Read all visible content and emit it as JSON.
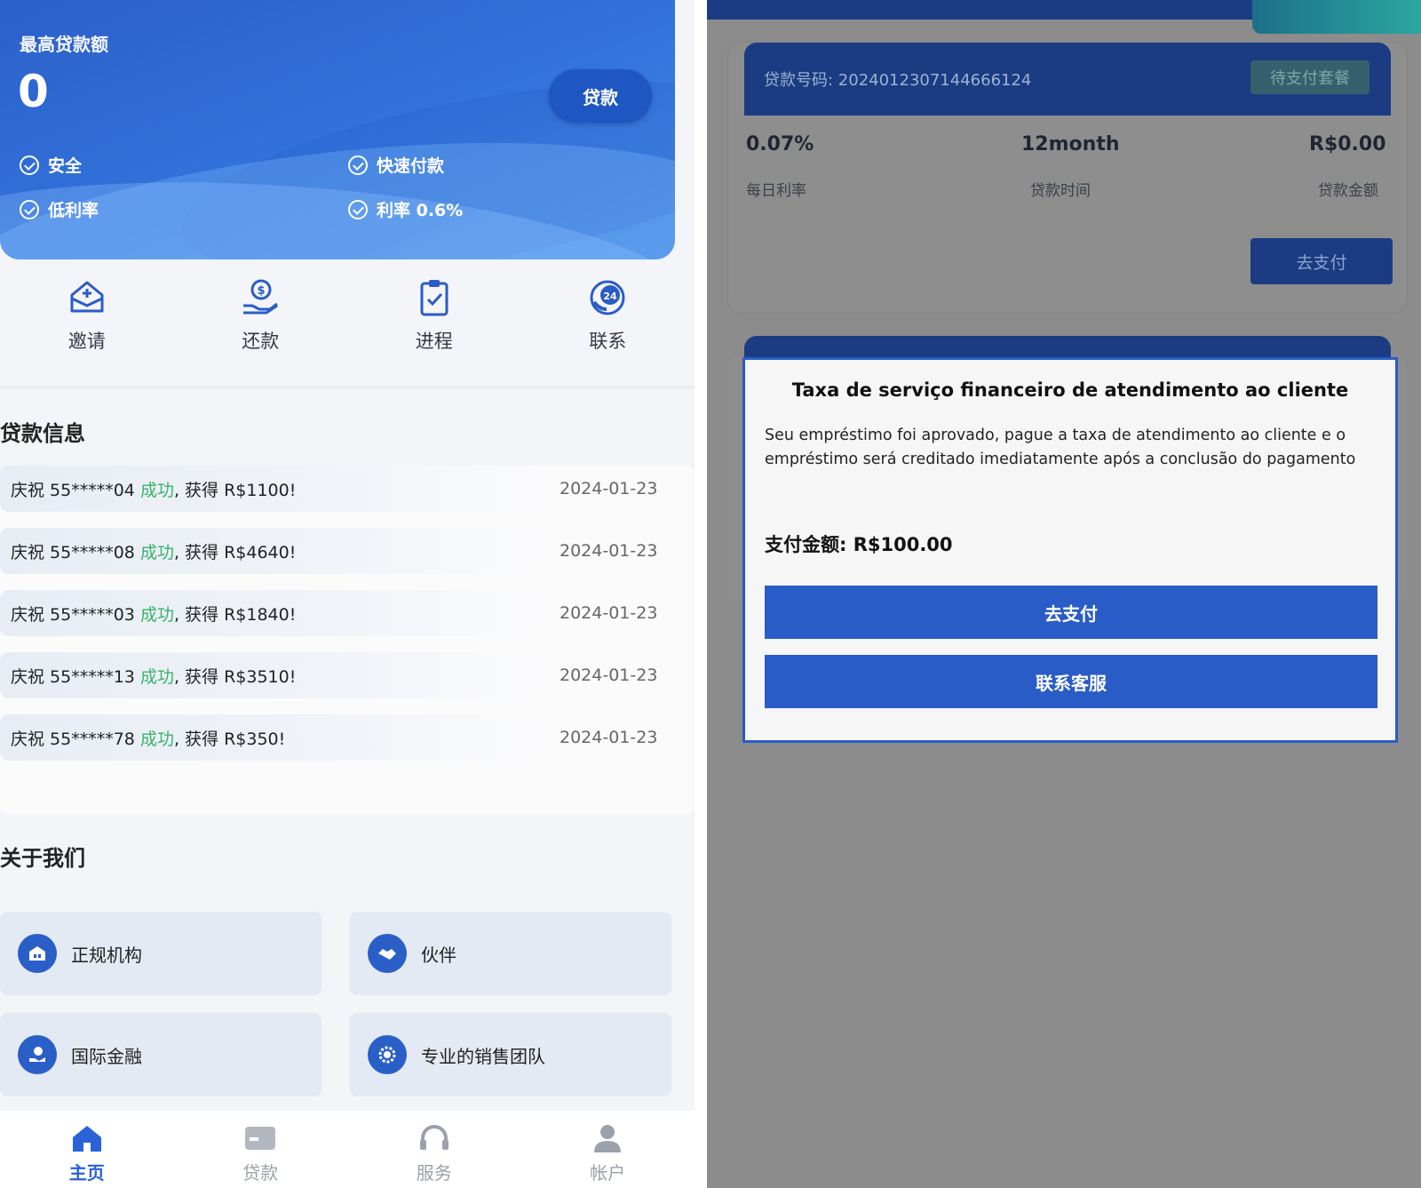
{
  "home": {
    "hero": {
      "label": "最高贷款额",
      "amount": "0",
      "button": "贷款",
      "features": [
        "安全",
        "快速付款",
        "低利率",
        "利率 0.6%"
      ]
    },
    "quick_actions": [
      {
        "label": "邀请",
        "icon": "invite-box-icon"
      },
      {
        "label": "还款",
        "icon": "repay-hand-coin-icon"
      },
      {
        "label": "进程",
        "icon": "clipboard-check-icon"
      },
      {
        "label": "联系",
        "icon": "24h-service-icon"
      }
    ],
    "loan_info_title": "贷款信息",
    "loan_records": [
      {
        "prefix": "庆祝 55*****04 ",
        "status": "成功",
        "suffix": ", 获得 R$1100!",
        "date": "2024-01-23"
      },
      {
        "prefix": "庆祝 55*****08 ",
        "status": "成功",
        "suffix": ", 获得 R$4640!",
        "date": "2024-01-23"
      },
      {
        "prefix": "庆祝 55*****03 ",
        "status": "成功",
        "suffix": ", 获得 R$1840!",
        "date": "2024-01-23"
      },
      {
        "prefix": "庆祝 55*****13 ",
        "status": "成功",
        "suffix": ", 获得 R$3510!",
        "date": "2024-01-23"
      },
      {
        "prefix": "庆祝 55*****78 ",
        "status": "成功",
        "suffix": ", 获得 R$350!",
        "date": "2024-01-23"
      }
    ],
    "about_title": "关于我们",
    "about_items": [
      {
        "label": "正规机构",
        "icon": "institution-icon"
      },
      {
        "label": "伙伴",
        "icon": "handshake-icon"
      },
      {
        "label": "国际金融",
        "icon": "finance-icon"
      },
      {
        "label": "专业的销售团队",
        "icon": "team-gear-icon"
      }
    ],
    "tabs": [
      {
        "label": "主页",
        "icon": "home-icon",
        "active": true
      },
      {
        "label": "贷款",
        "icon": "card-icon",
        "active": false
      },
      {
        "label": "服务",
        "icon": "headset-icon",
        "active": false
      },
      {
        "label": "帐户",
        "icon": "user-icon",
        "active": false
      }
    ]
  },
  "order": {
    "loan_number": "贷款号码: 2024012307144666124",
    "status": "待支付套餐",
    "stats": [
      {
        "value": "0.07%",
        "label": "每日利率"
      },
      {
        "value": "12month",
        "label": "贷款时间"
      },
      {
        "value": "R$0.00",
        "label": "贷款金额"
      }
    ],
    "pay_button": "去支付"
  },
  "modal": {
    "title": "Taxa de serviço financeiro de atendimento ao cliente",
    "body": "Seu empréstimo foi aprovado, pague a taxa de atendimento ao cliente e o empréstimo será creditado imediatamente após a conclusão do pagamento",
    "amount": "支付金额: R$100.00",
    "primary_button": "去支付",
    "secondary_button": "联系客服"
  },
  "colors": {
    "brand_blue": "#2a5cc7",
    "dark_navy": "#1b3c82",
    "success_green": "#38b36b",
    "overlay_gray": "#8c8c8c"
  }
}
